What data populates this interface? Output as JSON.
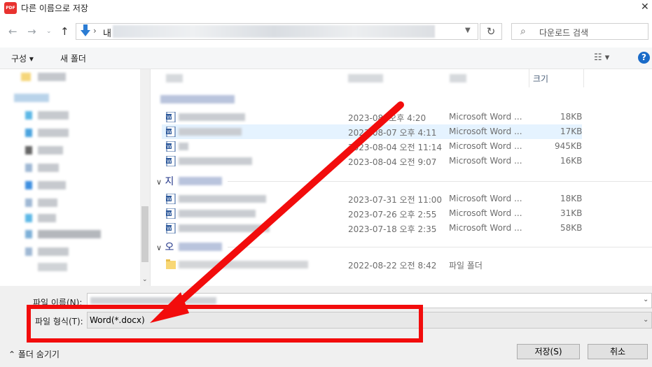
{
  "window": {
    "title": "다른 이름으로 저장",
    "app_icon": "PDF",
    "close": "✕"
  },
  "nav": {
    "address_prefix": "내",
    "address_sep": "›",
    "search_placeholder": "다운로드 검색"
  },
  "toolbar": {
    "organize": "구성 ▾",
    "new_folder": "새 폴더",
    "help": "?"
  },
  "columns": {
    "size": "크기"
  },
  "groups": [
    {
      "label": "지"
    },
    {
      "label": "오"
    }
  ],
  "files": [
    {
      "date": "2023-08- 오후 4:20",
      "type": "Microsoft Word ...",
      "size": "18KB"
    },
    {
      "date": "2023-08-07 오후 4:11",
      "type": "Microsoft Word ...",
      "size": "17KB"
    },
    {
      "date": "2023-08-04 오전 11:14",
      "type": "Microsoft Word ...",
      "size": "945KB"
    },
    {
      "date": "2023-08-04 오전 9:07",
      "type": "Microsoft Word ...",
      "size": "16KB"
    },
    {
      "date": "2023-07-31 오전 11:00",
      "type": "Microsoft Word ...",
      "size": "18KB"
    },
    {
      "date": "2023-07-26 오후 2:55",
      "type": "Microsoft Word ...",
      "size": "31KB"
    },
    {
      "date": "2023-07-18 오후 2:35",
      "type": "Microsoft Word ...",
      "size": "58KB"
    },
    {
      "date": "2022-08-22 오전 8:42",
      "type": "파일 폴더",
      "size": ""
    }
  ],
  "bottom": {
    "filename_label": "파일 이름(N):",
    "filetype_label": "파일 형식(T):",
    "filetype_value": "Word(*.docx)",
    "hide_folders": "폴더 숨기기",
    "save": "저장(S)",
    "cancel": "취소"
  },
  "colors": {
    "annotation": "#f20c0c",
    "accent": "#1a6bc8",
    "selection": "#e5f3ff"
  }
}
